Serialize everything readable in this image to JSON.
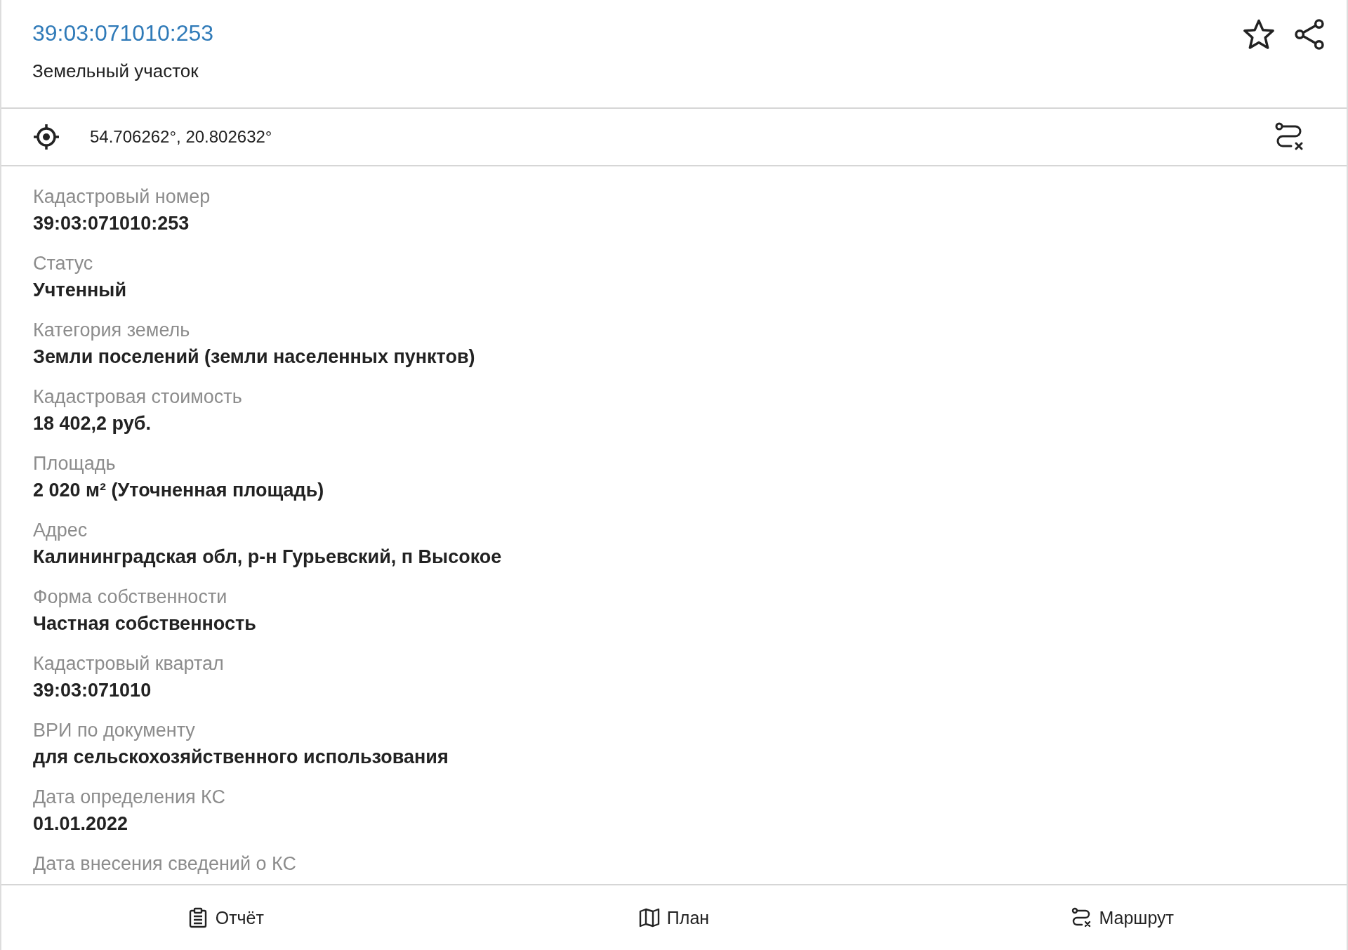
{
  "header": {
    "title": "39:03:071010:253",
    "subtitle": "Земельный участок"
  },
  "coordinates": "54.706262°, 20.802632°",
  "fields": [
    {
      "label": "Кадастровый номер",
      "value": "39:03:071010:253"
    },
    {
      "label": "Статус",
      "value": "Учтенный"
    },
    {
      "label": "Категория земель",
      "value": "Земли поселений (земли населенных пунктов)"
    },
    {
      "label": "Кадастровая стоимость",
      "value": "18 402,2 руб."
    },
    {
      "label": "Площадь",
      "value": "2 020 м² (Уточненная площадь)"
    },
    {
      "label": "Адрес",
      "value": "Калининградская обл, р-н Гурьевский, п Высокое"
    },
    {
      "label": "Форма собственности",
      "value": "Частная собственность"
    },
    {
      "label": "Кадастровый квартал",
      "value": "39:03:071010"
    },
    {
      "label": "ВРИ по документу",
      "value": "для сельскохозяйственного использования"
    },
    {
      "label": "Дата определения КС",
      "value": "01.01.2022"
    },
    {
      "label": "Дата внесения сведений о КС"
    }
  ],
  "actions": [
    {
      "kind": "report",
      "label": "Отчёт"
    },
    {
      "kind": "plan",
      "label": "План"
    },
    {
      "kind": "route",
      "label": "Маршрут"
    }
  ]
}
